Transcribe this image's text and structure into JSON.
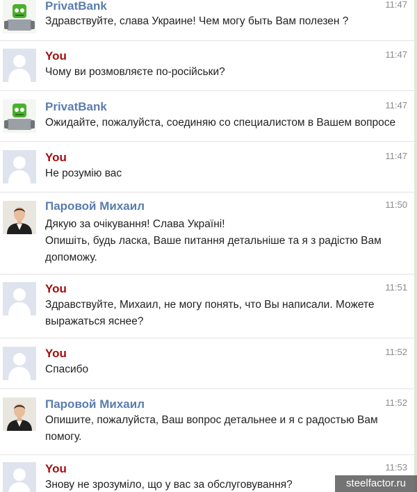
{
  "colors": {
    "bank_name": "#5a7dae",
    "you_name": "#a30f0f",
    "agent_name": "#5a7dae"
  },
  "messages": [
    {
      "author": "PrivatBank",
      "time": "11:47",
      "lines": [
        "Здравствуйте, слава Украине! Чем могу быть Вам полезен ?"
      ]
    },
    {
      "author": "You",
      "time": "11:47",
      "lines": [
        "Чому ви розмовляєте по-російськи?"
      ]
    },
    {
      "author": "PrivatBank",
      "time": "11:47",
      "lines": [
        "Ожидайте, пожалуйста, соединяю со специалистом в Вашем вопросе"
      ]
    },
    {
      "author": "You",
      "time": "11:47",
      "lines": [
        "Не розумію вас"
      ]
    },
    {
      "author": "Паровой Михаил",
      "time": "11:50",
      "lines": [
        "Дякую за очікування! Слава Україні!",
        "Опишіть, будь ласка, Ваше питання детальніше та я з радістю Вам",
        "допоможу."
      ]
    },
    {
      "author": "You",
      "time": "11:51",
      "lines": [
        "Здравствуйте, Михаил, не могу понять, что Вы написали. Можете",
        "выражаться яснее?"
      ]
    },
    {
      "author": "You",
      "time": "11:52",
      "lines": [
        "Спасибо"
      ]
    },
    {
      "author": "Паровой Михаил",
      "time": "11:52",
      "lines": [
        "Опишите, пожалуйста, Ваш вопрос детальнее и я с радостью Вам",
        "помогу."
      ]
    },
    {
      "author": "You",
      "time": "11:53",
      "lines": [
        "Знову не зрозуміло, що у вас за обслуговування?"
      ]
    }
  ],
  "watermark": "steelfactor.ru"
}
